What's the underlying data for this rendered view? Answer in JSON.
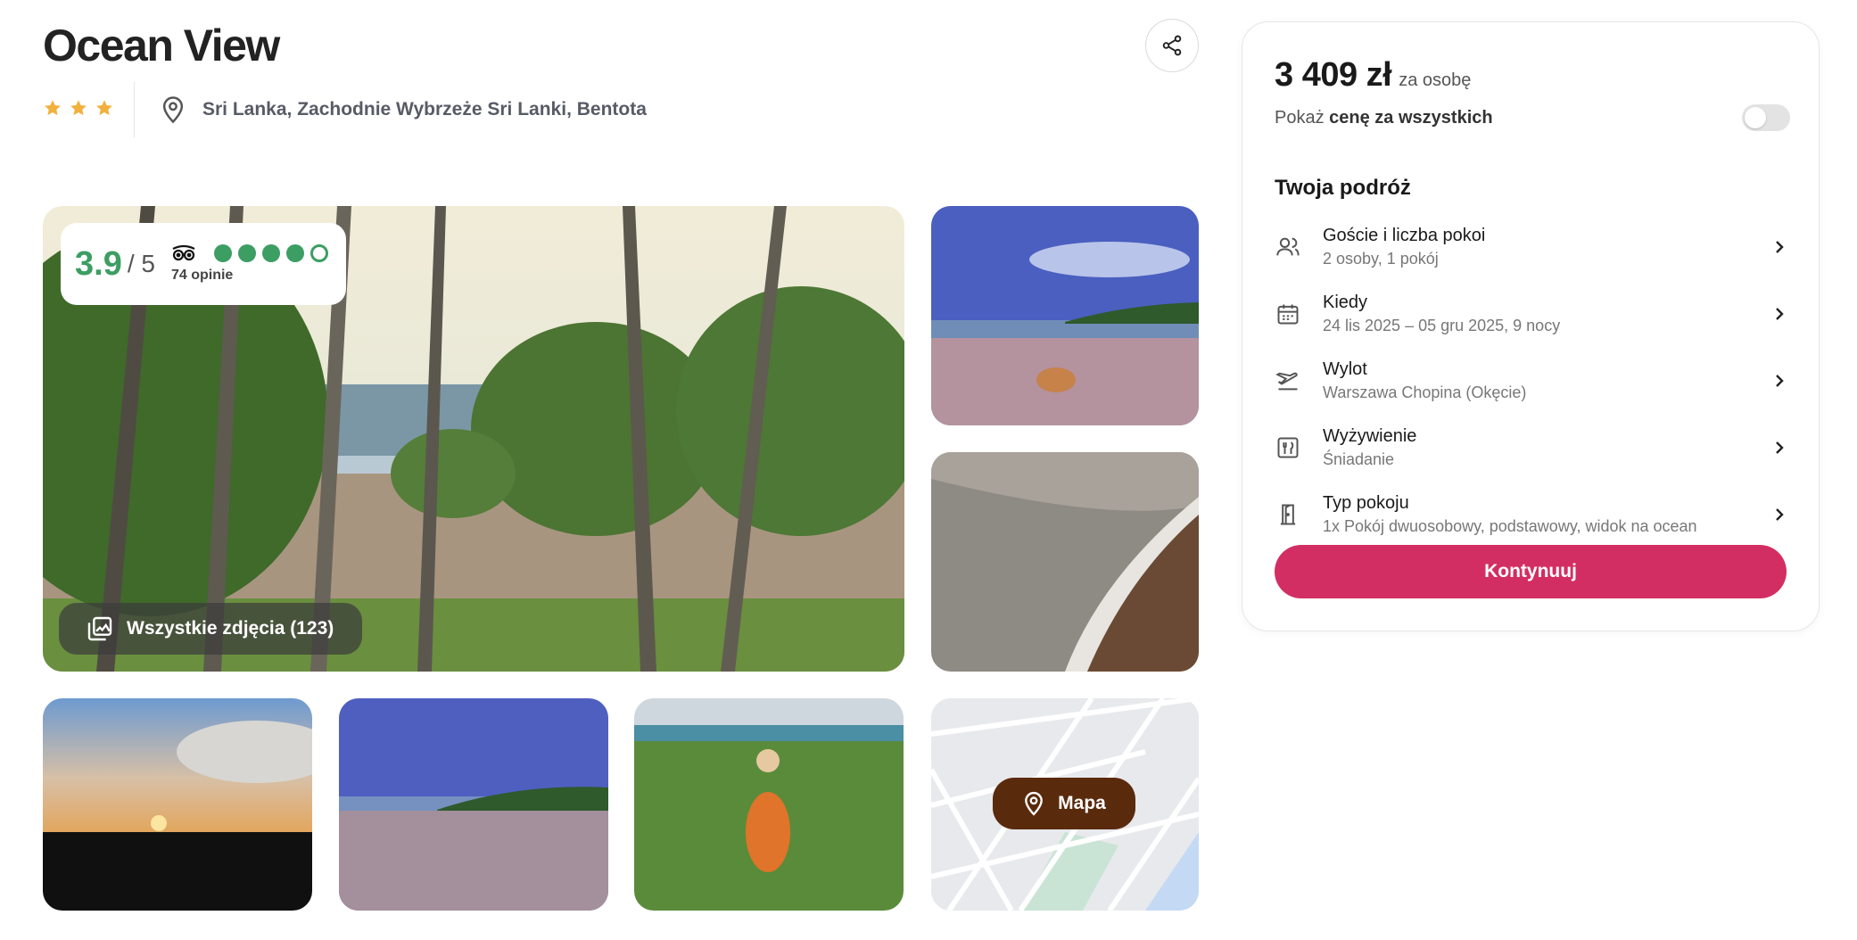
{
  "hotel": {
    "name": "Ocean View",
    "stars": 3,
    "location": "Sri Lanka, Zachodnie Wybrzeże Sri Lanki, Bentota"
  },
  "rating": {
    "value": "3.9",
    "max": "/ 5",
    "reviews": "74 opinie",
    "circles_filled": 4,
    "circles_total": 5,
    "color": "#3c9e63"
  },
  "gallery": {
    "all_photos_label": "Wszystkie zdjęcia (123)",
    "map_label": "Mapa"
  },
  "booking": {
    "price": "3 409 zł",
    "price_unit": "za osobę",
    "toggle_prefix": "Pokaż",
    "toggle_bold": "cenę za wszystkich",
    "toggle_on": false,
    "trip_title": "Twoja podróż",
    "items": [
      {
        "label": "Goście i liczba pokoi",
        "value": "2 osoby, 1 pokój",
        "icon": "guests-icon"
      },
      {
        "label": "Kiedy",
        "value": "24 lis 2025 – 05 gru 2025, 9 nocy",
        "icon": "calendar-icon"
      },
      {
        "label": "Wylot",
        "value": "Warszawa Chopina (Okęcie)",
        "icon": "plane-departure-icon"
      },
      {
        "label": "Wyżywienie",
        "value": "Śniadanie",
        "icon": "meal-icon"
      },
      {
        "label": "Typ pokoju",
        "value": "1x Pokój dwuosobowy, podstawowy, widok na ocean",
        "icon": "door-icon"
      }
    ],
    "continue_label": "Kontynuuj",
    "accent_color": "#d32e63"
  }
}
